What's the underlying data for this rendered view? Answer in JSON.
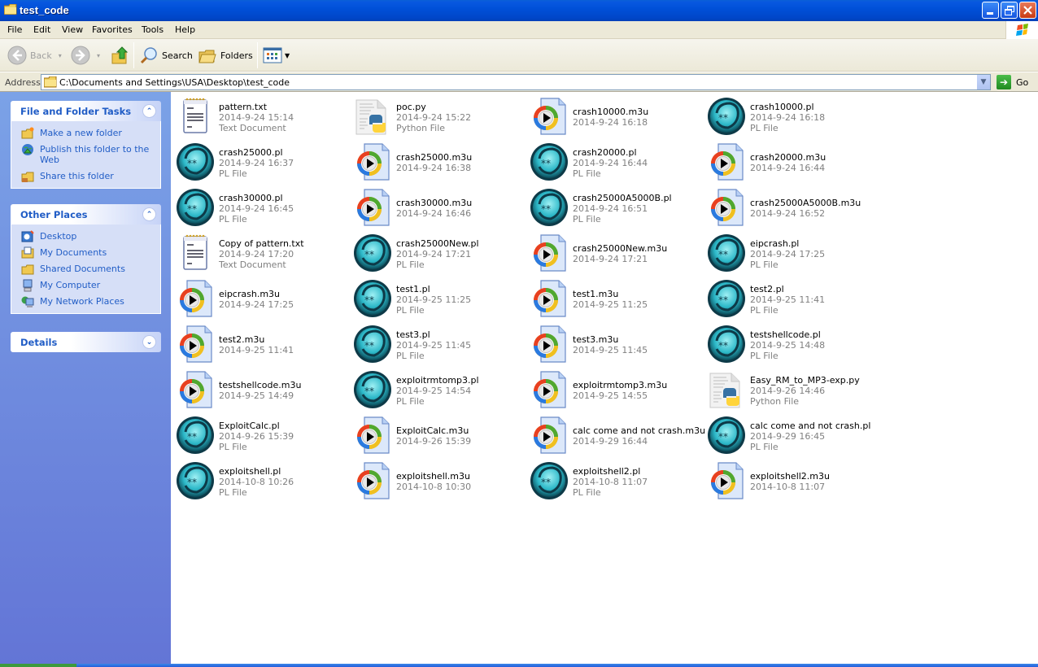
{
  "window": {
    "title": "test_code",
    "controls": {
      "minimize": "minimize",
      "restore": "restore",
      "close": "close"
    }
  },
  "menu": [
    "File",
    "Edit",
    "View",
    "Favorites",
    "Tools",
    "Help"
  ],
  "toolbar": {
    "back_label": "Back",
    "search_label": "Search",
    "folders_label": "Folders"
  },
  "address": {
    "label": "Address",
    "path": "C:\\Documents and Settings\\USA\\Desktop\\test_code",
    "go_label": "Go"
  },
  "sidebar": {
    "file_tasks": {
      "title": "File and Folder Tasks",
      "items": [
        {
          "label": "Make a new folder",
          "icon": "new-folder-icon"
        },
        {
          "label": "Publish this folder to the Web",
          "icon": "publish-web-icon"
        },
        {
          "label": "Share this folder",
          "icon": "share-folder-icon"
        }
      ]
    },
    "other_places": {
      "title": "Other Places",
      "items": [
        {
          "label": "Desktop",
          "icon": "desktop-icon"
        },
        {
          "label": "My Documents",
          "icon": "my-documents-icon"
        },
        {
          "label": "Shared Documents",
          "icon": "shared-documents-icon"
        },
        {
          "label": "My Computer",
          "icon": "my-computer-icon"
        },
        {
          "label": "My Network Places",
          "icon": "network-places-icon"
        }
      ]
    },
    "details": {
      "title": "Details"
    }
  },
  "files": [
    {
      "name": "pattern.txt",
      "date": "2014-9-24 15:14",
      "type": "Text Document",
      "kind": "txt"
    },
    {
      "name": "poc.py",
      "date": "2014-9-24 15:22",
      "type": "Python File",
      "kind": "py"
    },
    {
      "name": "crash10000.m3u",
      "date": "2014-9-24 16:18",
      "type": "",
      "kind": "m3u"
    },
    {
      "name": "crash10000.pl",
      "date": "2014-9-24 16:18",
      "type": "PL File",
      "kind": "pl"
    },
    {
      "name": "crash25000.pl",
      "date": "2014-9-24 16:37",
      "type": "PL File",
      "kind": "pl"
    },
    {
      "name": "crash25000.m3u",
      "date": "2014-9-24 16:38",
      "type": "",
      "kind": "m3u"
    },
    {
      "name": "crash20000.pl",
      "date": "2014-9-24 16:44",
      "type": "PL File",
      "kind": "pl"
    },
    {
      "name": "crash20000.m3u",
      "date": "2014-9-24 16:44",
      "type": "",
      "kind": "m3u"
    },
    {
      "name": "crash30000.pl",
      "date": "2014-9-24 16:45",
      "type": "PL File",
      "kind": "pl"
    },
    {
      "name": "crash30000.m3u",
      "date": "2014-9-24 16:46",
      "type": "",
      "kind": "m3u"
    },
    {
      "name": "crash25000A5000B.pl",
      "date": "2014-9-24 16:51",
      "type": "PL File",
      "kind": "pl"
    },
    {
      "name": "crash25000A5000B.m3u",
      "date": "2014-9-24 16:52",
      "type": "",
      "kind": "m3u"
    },
    {
      "name": "Copy of pattern.txt",
      "date": "2014-9-24 17:20",
      "type": "Text Document",
      "kind": "txt"
    },
    {
      "name": "crash25000New.pl",
      "date": "2014-9-24 17:21",
      "type": "PL File",
      "kind": "pl"
    },
    {
      "name": "crash25000New.m3u",
      "date": "2014-9-24 17:21",
      "type": "",
      "kind": "m3u"
    },
    {
      "name": "eipcrash.pl",
      "date": "2014-9-24 17:25",
      "type": "PL File",
      "kind": "pl"
    },
    {
      "name": "eipcrash.m3u",
      "date": "2014-9-24 17:25",
      "type": "",
      "kind": "m3u"
    },
    {
      "name": "test1.pl",
      "date": "2014-9-25 11:25",
      "type": "PL File",
      "kind": "pl"
    },
    {
      "name": "test1.m3u",
      "date": "2014-9-25 11:25",
      "type": "",
      "kind": "m3u"
    },
    {
      "name": "test2.pl",
      "date": "2014-9-25 11:41",
      "type": "PL File",
      "kind": "pl"
    },
    {
      "name": "test2.m3u",
      "date": "2014-9-25 11:41",
      "type": "",
      "kind": "m3u"
    },
    {
      "name": "test3.pl",
      "date": "2014-9-25 11:45",
      "type": "PL File",
      "kind": "pl"
    },
    {
      "name": "test3.m3u",
      "date": "2014-9-25 11:45",
      "type": "",
      "kind": "m3u"
    },
    {
      "name": "testshellcode.pl",
      "date": "2014-9-25 14:48",
      "type": "PL File",
      "kind": "pl"
    },
    {
      "name": "testshellcode.m3u",
      "date": "2014-9-25 14:49",
      "type": "",
      "kind": "m3u"
    },
    {
      "name": "exploitrmtomp3.pl",
      "date": "2014-9-25 14:54",
      "type": "PL File",
      "kind": "pl"
    },
    {
      "name": "exploitrmtomp3.m3u",
      "date": "2014-9-25 14:55",
      "type": "",
      "kind": "m3u"
    },
    {
      "name": "Easy_RM_to_MP3-exp.py",
      "date": "2014-9-26 14:46",
      "type": "Python File",
      "kind": "py"
    },
    {
      "name": "ExploitCalc.pl",
      "date": "2014-9-26 15:39",
      "type": "PL File",
      "kind": "pl"
    },
    {
      "name": "ExploitCalc.m3u",
      "date": "2014-9-26 15:39",
      "type": "",
      "kind": "m3u"
    },
    {
      "name": "calc come and not crash.m3u",
      "date": "2014-9-29 16:44",
      "type": "",
      "kind": "m3u"
    },
    {
      "name": "calc come and not crash.pl",
      "date": "2014-9-29 16:45",
      "type": "PL File",
      "kind": "pl"
    },
    {
      "name": "exploitshell.pl",
      "date": "2014-10-8 10:26",
      "type": "PL File",
      "kind": "pl"
    },
    {
      "name": "exploitshell.m3u",
      "date": "2014-10-8 10:30",
      "type": "",
      "kind": "m3u"
    },
    {
      "name": "exploitshell2.pl",
      "date": "2014-10-8 11:07",
      "type": "PL File",
      "kind": "pl"
    },
    {
      "name": "exploitshell2.m3u",
      "date": "2014-10-8 11:07",
      "type": "",
      "kind": "m3u"
    }
  ]
}
